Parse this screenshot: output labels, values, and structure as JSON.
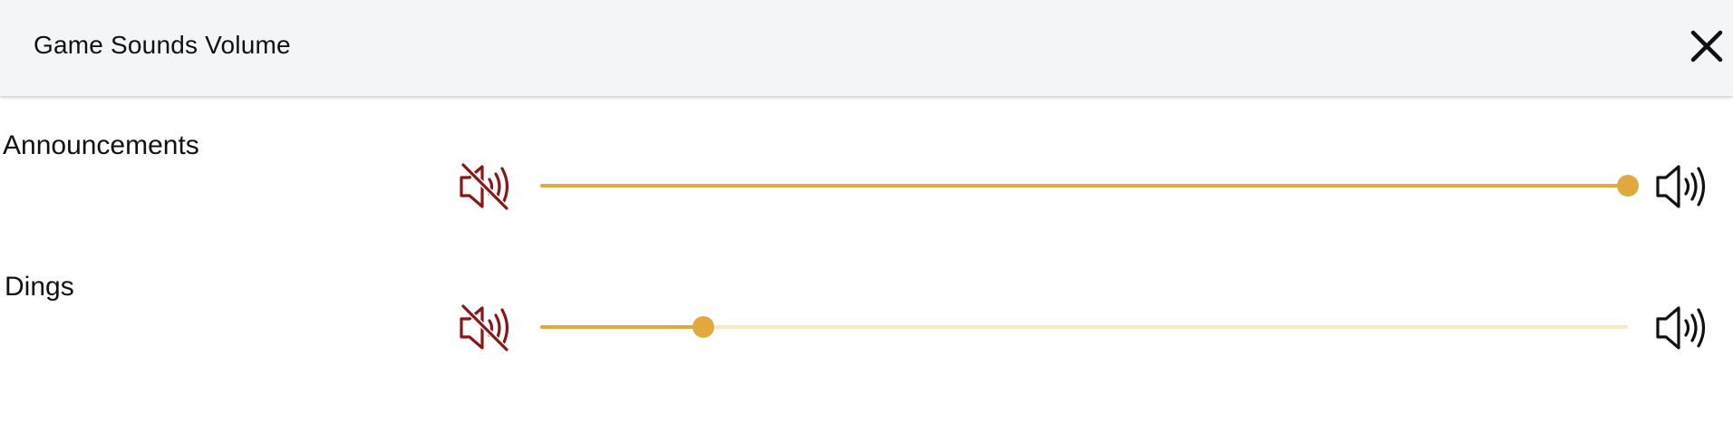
{
  "header": {
    "title": "Game Sounds Volume",
    "close_icon": "close-x-icon"
  },
  "colors": {
    "accent": "#e3a93f",
    "rail": "#f7e8c6",
    "mute_icon": "#8c1515",
    "icon": "#111111"
  },
  "controls": [
    {
      "id": "announcements",
      "label": "Announcements",
      "mute_icon": "volume-muted-icon",
      "max_icon": "volume-max-icon",
      "value": 100
    },
    {
      "id": "dings",
      "label": "Dings",
      "mute_icon": "volume-muted-icon",
      "max_icon": "volume-max-icon",
      "value": 15
    }
  ]
}
